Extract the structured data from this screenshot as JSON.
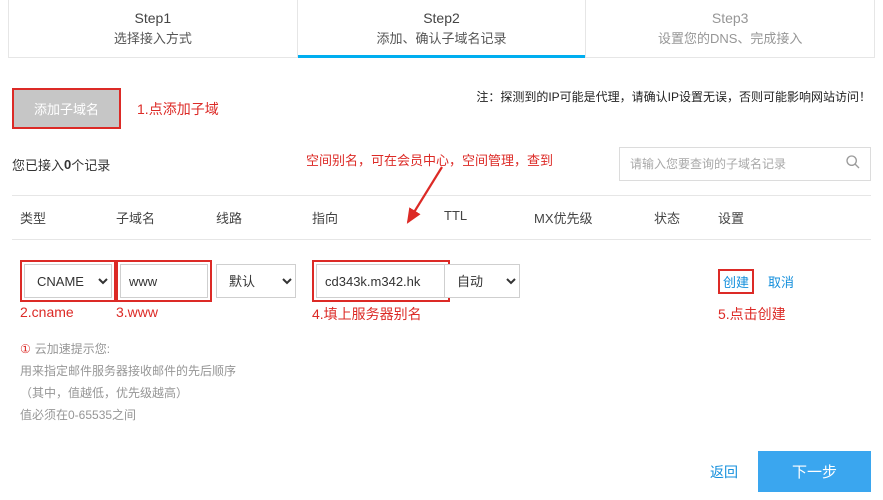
{
  "steps": [
    {
      "title": "Step1",
      "sub": "选择接入方式"
    },
    {
      "title": "Step2",
      "sub": "添加、确认子域名记录"
    },
    {
      "title": "Step3",
      "sub": "设置您的DNS、完成接入"
    }
  ],
  "toolbar": {
    "add_label": "添加子域名",
    "anno1": "1.点添加子域",
    "note": "注：探测到的IP可能是代理，请确认IP设置无误，否则可能影响网站访问！"
  },
  "status": {
    "prefix": "您已接入 ",
    "count": "0",
    "suffix": " 个记录"
  },
  "search": {
    "placeholder": "请输入您要查询的子域名记录"
  },
  "mid_anno": "空间别名，可在会员中心，空间管理，查到",
  "columns": {
    "type": "类型",
    "sub": "子域名",
    "line": "线路",
    "point": "指向",
    "ttl": "TTL",
    "mx": "MX优先级",
    "status": "状态",
    "set": "设置"
  },
  "row": {
    "type_value": "CNAME",
    "sub_value": "www",
    "line_value": "默认",
    "point_value": "cd343k.m342.hk",
    "ttl_value": "自动",
    "create": "创建",
    "cancel": "取消"
  },
  "row_anno": {
    "a2": "2.cname",
    "a3": "3.www",
    "a4": "4.填上服务器别名",
    "a5": "5.点击创建"
  },
  "hint": {
    "icon_label": "①",
    "l1": "云加速提示您:",
    "l2": "用来指定邮件服务器接收邮件的先后顺序",
    "l3": "（其中，值越低，优先级越高）",
    "l4": "值必须在0-65535之间"
  },
  "footer": {
    "back": "返回",
    "next": "下一步"
  }
}
